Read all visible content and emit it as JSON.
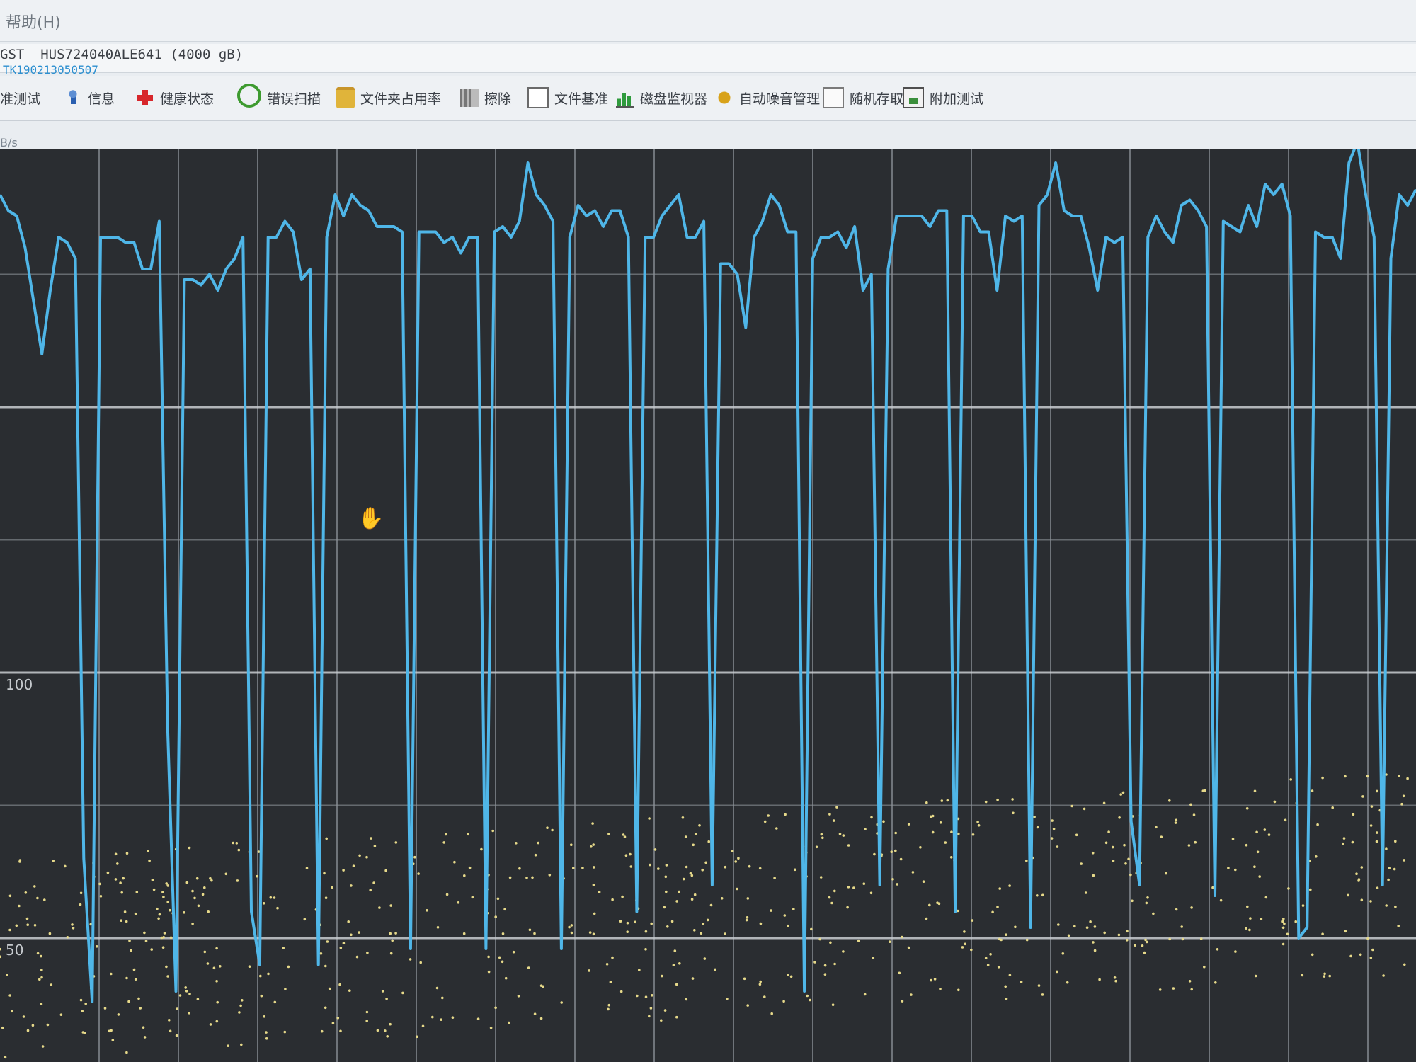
{
  "menu": {
    "help_label": "帮助(H)"
  },
  "drive": {
    "name": "GST  HUS724040ALE641 (4000 gB)",
    "serial": "TK190213050507"
  },
  "toolbar": {
    "tabs": [
      {
        "label": "准测试",
        "icon": ""
      },
      {
        "label": "信息",
        "icon": "info-icon"
      },
      {
        "label": "健康状态",
        "icon": "health-cross-icon"
      },
      {
        "label": "错误扫描",
        "icon": "magnifier-icon"
      },
      {
        "label": "文件夹占用率",
        "icon": "folder-icon"
      },
      {
        "label": "擦除",
        "icon": "trash-icon"
      },
      {
        "label": "文件基准",
        "icon": "file-benchmark-icon"
      },
      {
        "label": "磁盘监视器",
        "icon": "bar-chart-icon"
      },
      {
        "label": "自动噪音管理",
        "icon": "speaker-icon"
      },
      {
        "label": "随机存取",
        "icon": "random-access-icon"
      },
      {
        "label": "附加测试",
        "icon": "extra-tests-icon"
      }
    ]
  },
  "chart_data": {
    "type": "line",
    "ylabel": "B/s",
    "y_ticks": [
      "100",
      "50"
    ],
    "grid": true,
    "series": [
      {
        "color": "#4fb6e8",
        "values": [
          190,
          187,
          186,
          180,
          170,
          160,
          172,
          182,
          181,
          178,
          65,
          38,
          182,
          182,
          182,
          181,
          181,
          176,
          176,
          185,
          90,
          40,
          174,
          174,
          173,
          175,
          172,
          176,
          178,
          182,
          55,
          45,
          182,
          182,
          185,
          183,
          174,
          176,
          45,
          182,
          190,
          186,
          190,
          188,
          187,
          184,
          184,
          184,
          183,
          48,
          183,
          183,
          183,
          181,
          182,
          179,
          182,
          182,
          48,
          183,
          184,
          182,
          185,
          196,
          190,
          188,
          185,
          48,
          182,
          188,
          186,
          187,
          184,
          187,
          187,
          182,
          55,
          182,
          182,
          186,
          188,
          190,
          182,
          182,
          185,
          60,
          177,
          177,
          175,
          165,
          182,
          185,
          190,
          188,
          183,
          183,
          40,
          178,
          182,
          182,
          183,
          180,
          184,
          172,
          175,
          60,
          176,
          186,
          186,
          186,
          186,
          184,
          187,
          187,
          55,
          186,
          186,
          183,
          183,
          172,
          186,
          185,
          186,
          52,
          188,
          190,
          196,
          187,
          186,
          186,
          180,
          172,
          182,
          181,
          182,
          72,
          60,
          182,
          186,
          183,
          181,
          188,
          189,
          187,
          184,
          58,
          185,
          184,
          183,
          188,
          184,
          192,
          190,
          192,
          186,
          50,
          52,
          183,
          182,
          182,
          178,
          196,
          200,
          190,
          182,
          60,
          178,
          190,
          188,
          191
        ]
      }
    ]
  }
}
